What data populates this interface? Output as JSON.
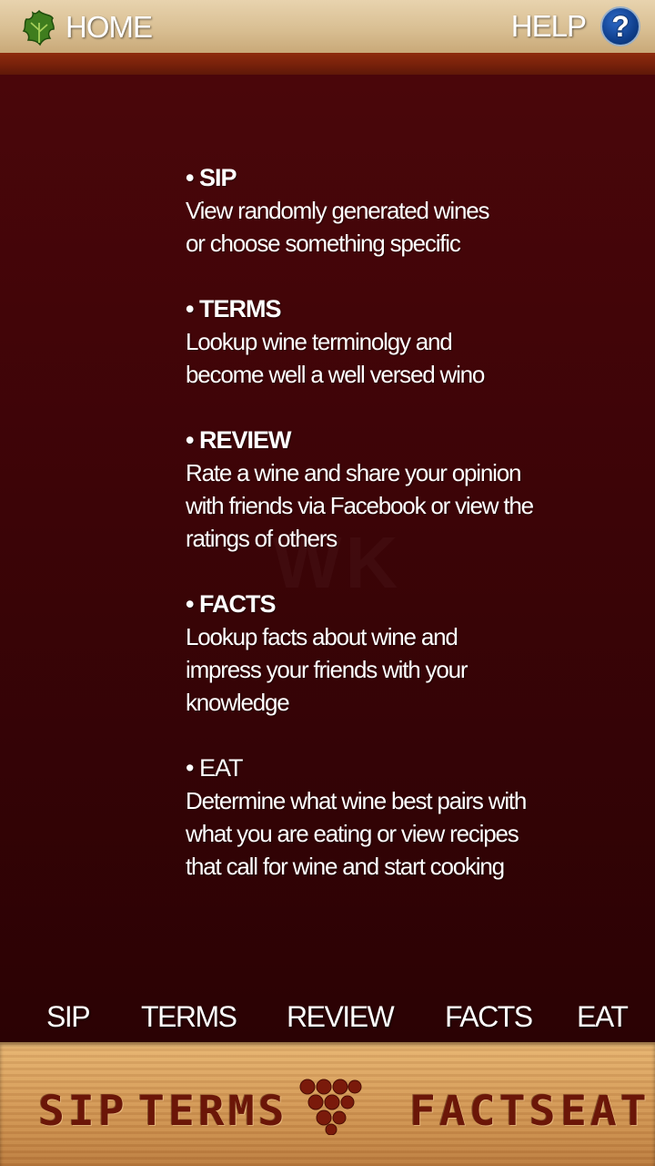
{
  "header": {
    "home_label": "HOME",
    "help_label": "HELP",
    "help_icon_glyph": "?"
  },
  "sections": [
    {
      "title": "• SIP",
      "lines": [
        "View randomly generated wines",
        "or choose something specific"
      ]
    },
    {
      "title": "• TERMS",
      "lines": [
        "Lookup wine terminolgy and",
        "become well a well versed wino"
      ]
    },
    {
      "title": "• REVIEW",
      "lines": [
        "Rate a wine and share your opinion",
        "with friends via Facebook or view the",
        "ratings of others"
      ]
    },
    {
      "title": "• FACTS",
      "lines": [
        "Lookup facts about wine and",
        "impress your friends with your",
        "knowledge"
      ]
    },
    {
      "title": "• EAT",
      "lines": [
        "Determine what wine best pairs with",
        "what you are eating or view recipes",
        "that call for wine and start cooking"
      ]
    }
  ],
  "tab_labels": [
    "SIP",
    "TERMS",
    "REVIEW",
    "FACTS",
    "EAT"
  ],
  "bottom_nav": [
    "SIP",
    "TERMS",
    "FACTS",
    "EAT"
  ],
  "icons": {
    "home": "vine-leaf-icon",
    "help": "question-icon",
    "center": "grapes-icon"
  },
  "colors": {
    "accent": "#3a0406",
    "wood": "#d79e5b",
    "carved_text": "#6b1608"
  }
}
